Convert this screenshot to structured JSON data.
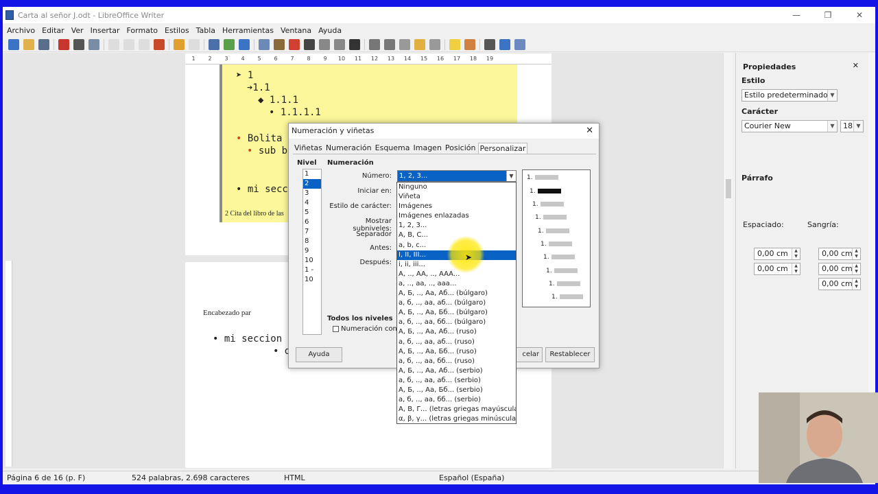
{
  "window": {
    "title": "Carta al señor J.odt - LibreOffice Writer",
    "controls": [
      "—",
      "❐",
      "✕"
    ]
  },
  "menubar": [
    "Archivo",
    "Editar",
    "Ver",
    "Insertar",
    "Formato",
    "Estilos",
    "Tabla",
    "Herramientas",
    "Ventana",
    "Ayuda"
  ],
  "ruler": [
    "1",
    "2",
    "3",
    "4",
    "5",
    "6",
    "7",
    "8",
    "9",
    "10",
    "11",
    "12",
    "13",
    "14",
    "15",
    "16",
    "17",
    "18",
    "19"
  ],
  "document": {
    "page1_lines": [
      "➤ 1",
      "➔1.1",
      "◆ 1.1.1",
      "• 1.1.1.1",
      "Bolita",
      "sub b",
      "mi secc"
    ],
    "caption": "2 Cita del libro de las",
    "page2_heading": "Encabezado par",
    "page2_lines": [
      "mi seccion",
      "de"
    ]
  },
  "sidebar": {
    "title": "Propiedades",
    "close": "✕",
    "style_section": "Estilo",
    "style_value": "Estilo predeterminado",
    "char_section": "Carácter",
    "font_name": "Courier New",
    "font_size": "18",
    "para_section": "Párrafo",
    "spacing_label": "Espaciado:",
    "indent_label": "Sangría:",
    "spin_values": [
      "0,00 cm",
      "0,00 cm",
      "0,00 cm",
      "0,00 cm",
      "0,00 cm"
    ]
  },
  "statusbar": {
    "page": "Página 6 de 16 (p. F)",
    "words": "524 palabras, 2.698 caracteres",
    "format": "HTML",
    "language": "Español (España)"
  },
  "dialog": {
    "title": "Numeración y viñetas",
    "close": "✕",
    "tabs": [
      "Viñetas",
      "Numeración",
      "Esquema",
      "Imagen",
      "Posición",
      "Personalizar"
    ],
    "active_tab": "Personalizar",
    "level_label": "Nivel",
    "levels": [
      "1",
      "2",
      "3",
      "4",
      "5",
      "6",
      "7",
      "8",
      "9",
      "10",
      "1 - 10"
    ],
    "selected_level": "2",
    "numbering_label": "Numeración",
    "fields": {
      "number": "Número:",
      "start_at": "Iniciar en:",
      "char_style": "Estilo de carácter:",
      "show_sublevels": "Mostrar subniveles:",
      "separator": "Separador",
      "before": "Antes:",
      "after": "Después:"
    },
    "number_value": "1, 2, 3...",
    "number_options": [
      "Ninguno",
      "Viñeta",
      "Imágenes",
      "Imágenes enlazadas",
      "1, 2, 3...",
      "A, B, C...",
      "a, b, c...",
      "I, II, III...",
      "i, ii, iii...",
      "A, .., AA, .., AAA...",
      "a, .., aa, .., aaa...",
      "А, Б, .., Аа, Аб... (búlgaro)",
      "а, б, .., аа, аб... (búlgaro)",
      "А, Б, .., Аа, Бб... (búlgaro)",
      "а, б, .., аа, бб... (búlgaro)",
      "А, Б, .., Аа, Аб... (ruso)",
      "а, б, .., аа, аб... (ruso)",
      "А, Б, .., Аа, Бб... (ruso)",
      "а, б, .., аа, бб... (ruso)",
      "А, Б, .., Аа, Аб... (serbio)",
      "а, б, .., аа, аб... (serbio)",
      "А, Б, .., Аа, Бб... (serbio)",
      "а, б, .., аа, бб... (serbio)",
      "Α, Β, Γ... (letras griegas mayúsculas)",
      "α, β, γ... (letras griegas minúsculas)"
    ],
    "highlighted_option": "I, II, III...",
    "all_levels_label": "Todos los niveles",
    "consecutive_label": "Numeración conse",
    "preview_label": "1.",
    "buttons": {
      "help": "Ayuda",
      "cancel": "celar",
      "reset": "Restablecer"
    }
  },
  "colors": {
    "accent": "#0a62c4",
    "desktop": "#1414e6",
    "highlight": "#fbf79a"
  }
}
